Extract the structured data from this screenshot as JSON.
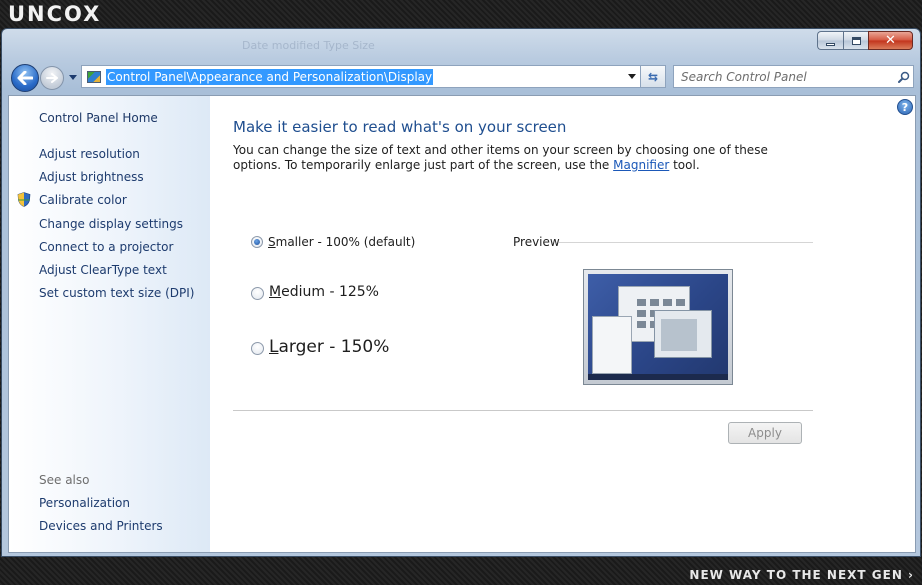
{
  "brand": {
    "logo_text": "UNCOX",
    "tagline": "NEW WAY TO THE NEXT GEN ›"
  },
  "titlebar": {
    "ghost_text": "Date modified        Type             Size"
  },
  "navigation": {
    "address_path": "Control Panel\\Appearance and Personalization\\Display",
    "search_placeholder": "Search Control Panel"
  },
  "sidebar": {
    "home": "Control Panel Home",
    "links": [
      "Adjust resolution",
      "Adjust brightness",
      "Calibrate color",
      "Change display settings",
      "Connect to a projector",
      "Adjust ClearType text",
      "Set custom text size (DPI)"
    ],
    "see_also_heading": "See also",
    "see_also_links": [
      "Personalization",
      "Devices and Printers"
    ]
  },
  "main": {
    "title": "Make it easier to read what's on your screen",
    "description_before": "You can change the size of text and other items on your screen by choosing one of these options. To temporarily enlarge just part of the screen, use the ",
    "description_link": "Magnifier",
    "description_after": " tool.",
    "options": [
      {
        "first_letter": "S",
        "rest": "maller - 100% (default)",
        "selected": true
      },
      {
        "first_letter": "M",
        "rest": "edium - 125%",
        "selected": false
      },
      {
        "first_letter": "L",
        "rest": "arger - 150%",
        "selected": false
      }
    ],
    "preview_label": "Preview",
    "apply_label": "Apply"
  }
}
